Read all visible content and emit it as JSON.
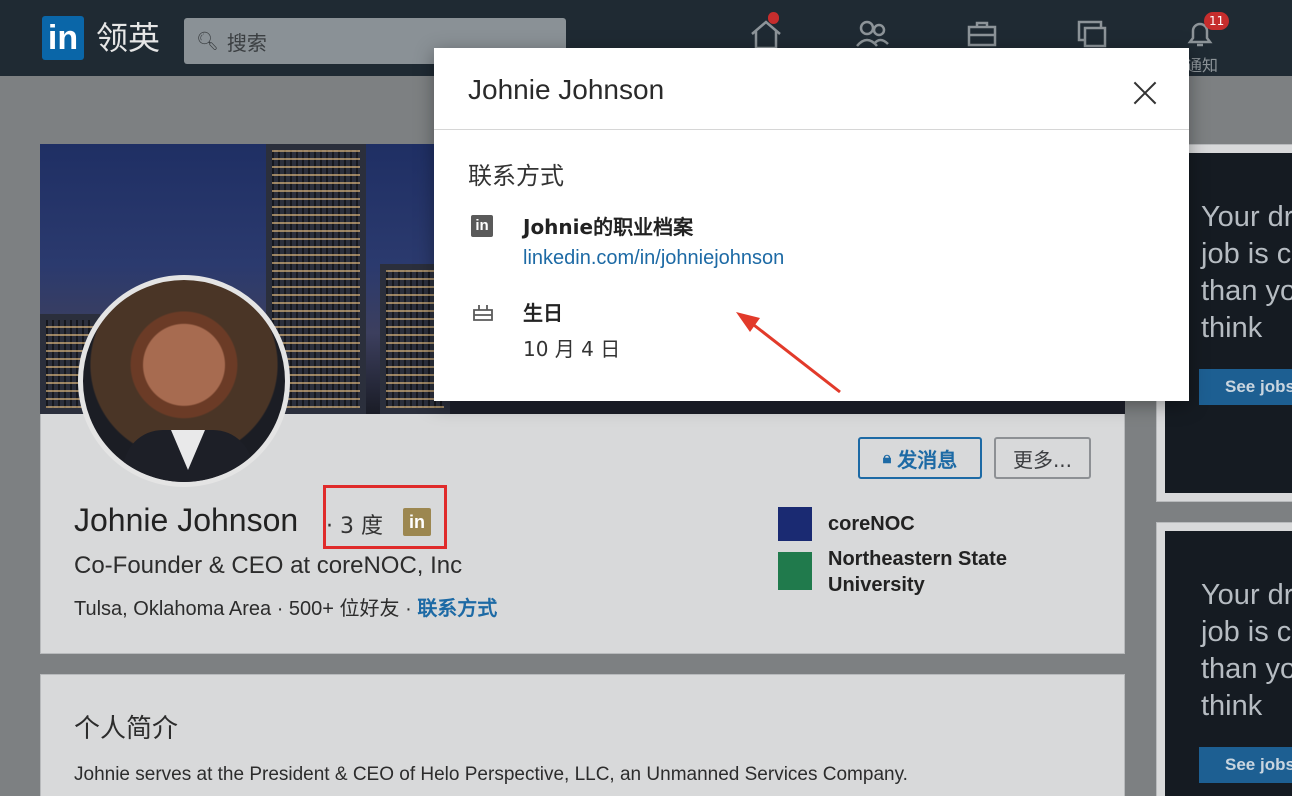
{
  "nav": {
    "logo_mark": "in",
    "logo_text": "领英",
    "search_placeholder": "搜索",
    "notifications_badge": "11",
    "notifications_label": "通知"
  },
  "profile": {
    "name": "Johnie Johnson",
    "degree": "· 3 度",
    "degree_badge": "in",
    "headline": "Co-Founder & CEO at coreNOC, Inc",
    "location": "Tulsa, Oklahoma Area",
    "connections": "500+ 位好友",
    "contact_link": "联系方式",
    "message_button": "发消息",
    "more_button": "更多...",
    "company": "coreNOC",
    "school_line1": "Northeastern State",
    "school_line2": "University"
  },
  "about": {
    "title": "个人简介",
    "text": "Johnie serves at the President & CEO of Helo Perspective, LLC, an Unmanned Services Company."
  },
  "ads": [
    {
      "text": "Your dr\njob is c\nthan yo\nthink",
      "button": "See jobs"
    },
    {
      "text": "Your dr\njob is c\nthan yo\nthink",
      "button": "See jobs"
    }
  ],
  "modal": {
    "title": "Johnie Johnson",
    "section_title": "联系方式",
    "profile_label": "Johnie的职业档案",
    "profile_url": "linkedin.com/in/johniejohnson",
    "birthday_label": "生日",
    "birthday_value": "10 月 4 日"
  },
  "colors": {
    "nav_bg": "#1f2a33",
    "link_blue": "#1d6aa5",
    "highlight_red": "#e02b2b"
  }
}
